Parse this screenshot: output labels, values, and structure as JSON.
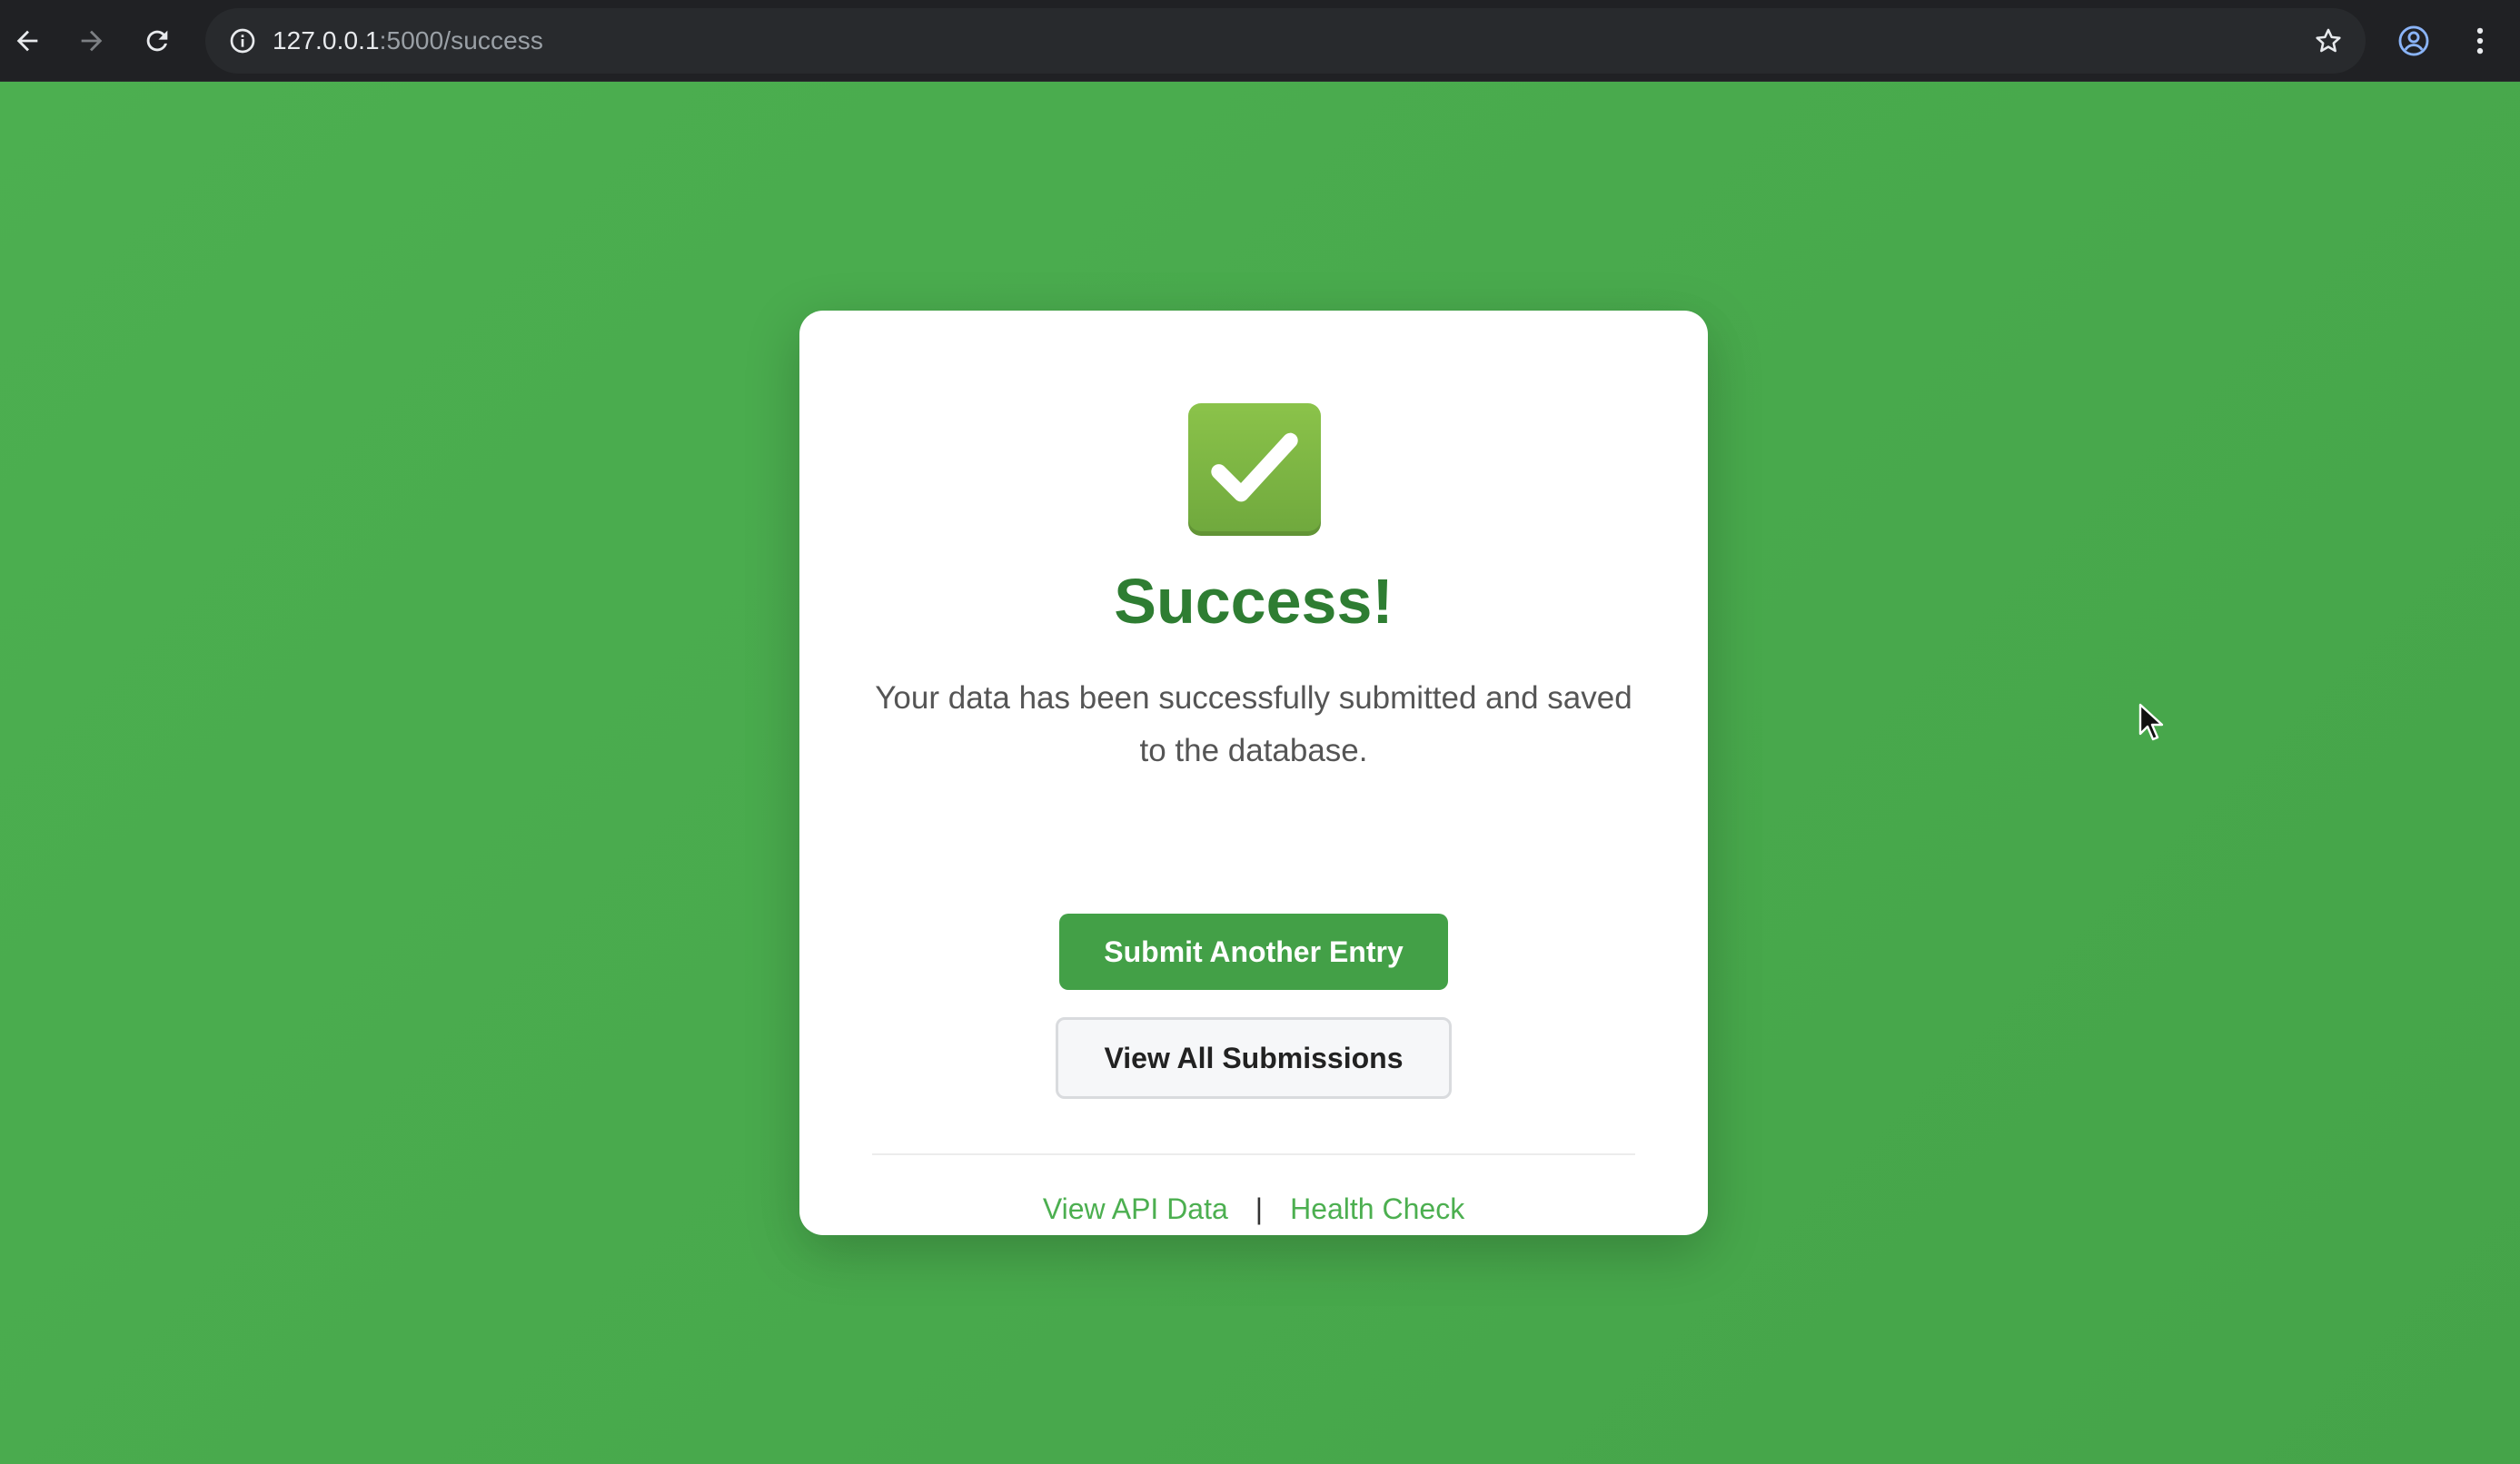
{
  "browser": {
    "url_host": "127.0.0.1",
    "url_path": ":5000/success"
  },
  "icons": {
    "back": "arrow-left-icon",
    "forward": "arrow-right-icon",
    "reload": "reload-icon",
    "site_info": "info-icon",
    "bookmark": "star-icon",
    "profile": "account-icon",
    "menu": "kebab-menu-icon",
    "success": "check-mark-button-icon"
  },
  "card": {
    "title": "Success!",
    "message": "Your data has been successfully submitted and saved to the database.",
    "primary_button": "Submit Another Entry",
    "secondary_button": "View All Submissions",
    "link_api": "View API Data",
    "separator": "|",
    "link_health": "Health Check"
  },
  "colors": {
    "background": "#4caf50",
    "title": "#2e7d32",
    "primary_button": "#43a047",
    "link": "#4caf50"
  }
}
